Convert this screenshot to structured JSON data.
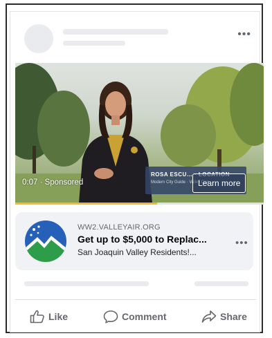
{
  "post": {
    "more_glyph": "•••"
  },
  "video": {
    "timestamp": "0:07 · Sponsored",
    "lower_third_name": "ROSA ESCU… · LOCATION",
    "lower_third_sub": "Modern City Guide · Valley Dist.",
    "cta": "Learn more",
    "progress_fraction": 0.57,
    "progress_color": "#f7b928"
  },
  "ad": {
    "domain": "WW2.VALLEYAIR.ORG",
    "title": "Get up to $5,000 to Replac...",
    "description": "San Joaquin Valley Residents!...",
    "more_glyph": "•••",
    "logo_icon": "valley-air-logo-icon"
  },
  "actions": [
    {
      "label": "Like",
      "icon": "thumbs-up-icon"
    },
    {
      "label": "Comment",
      "icon": "comment-bubble-icon"
    },
    {
      "label": "Share",
      "icon": "share-arrow-icon"
    }
  ],
  "colors": {
    "placeholder": "#e9ebee",
    "ad_background": "#f0f2f5",
    "action_text": "#65676b"
  }
}
